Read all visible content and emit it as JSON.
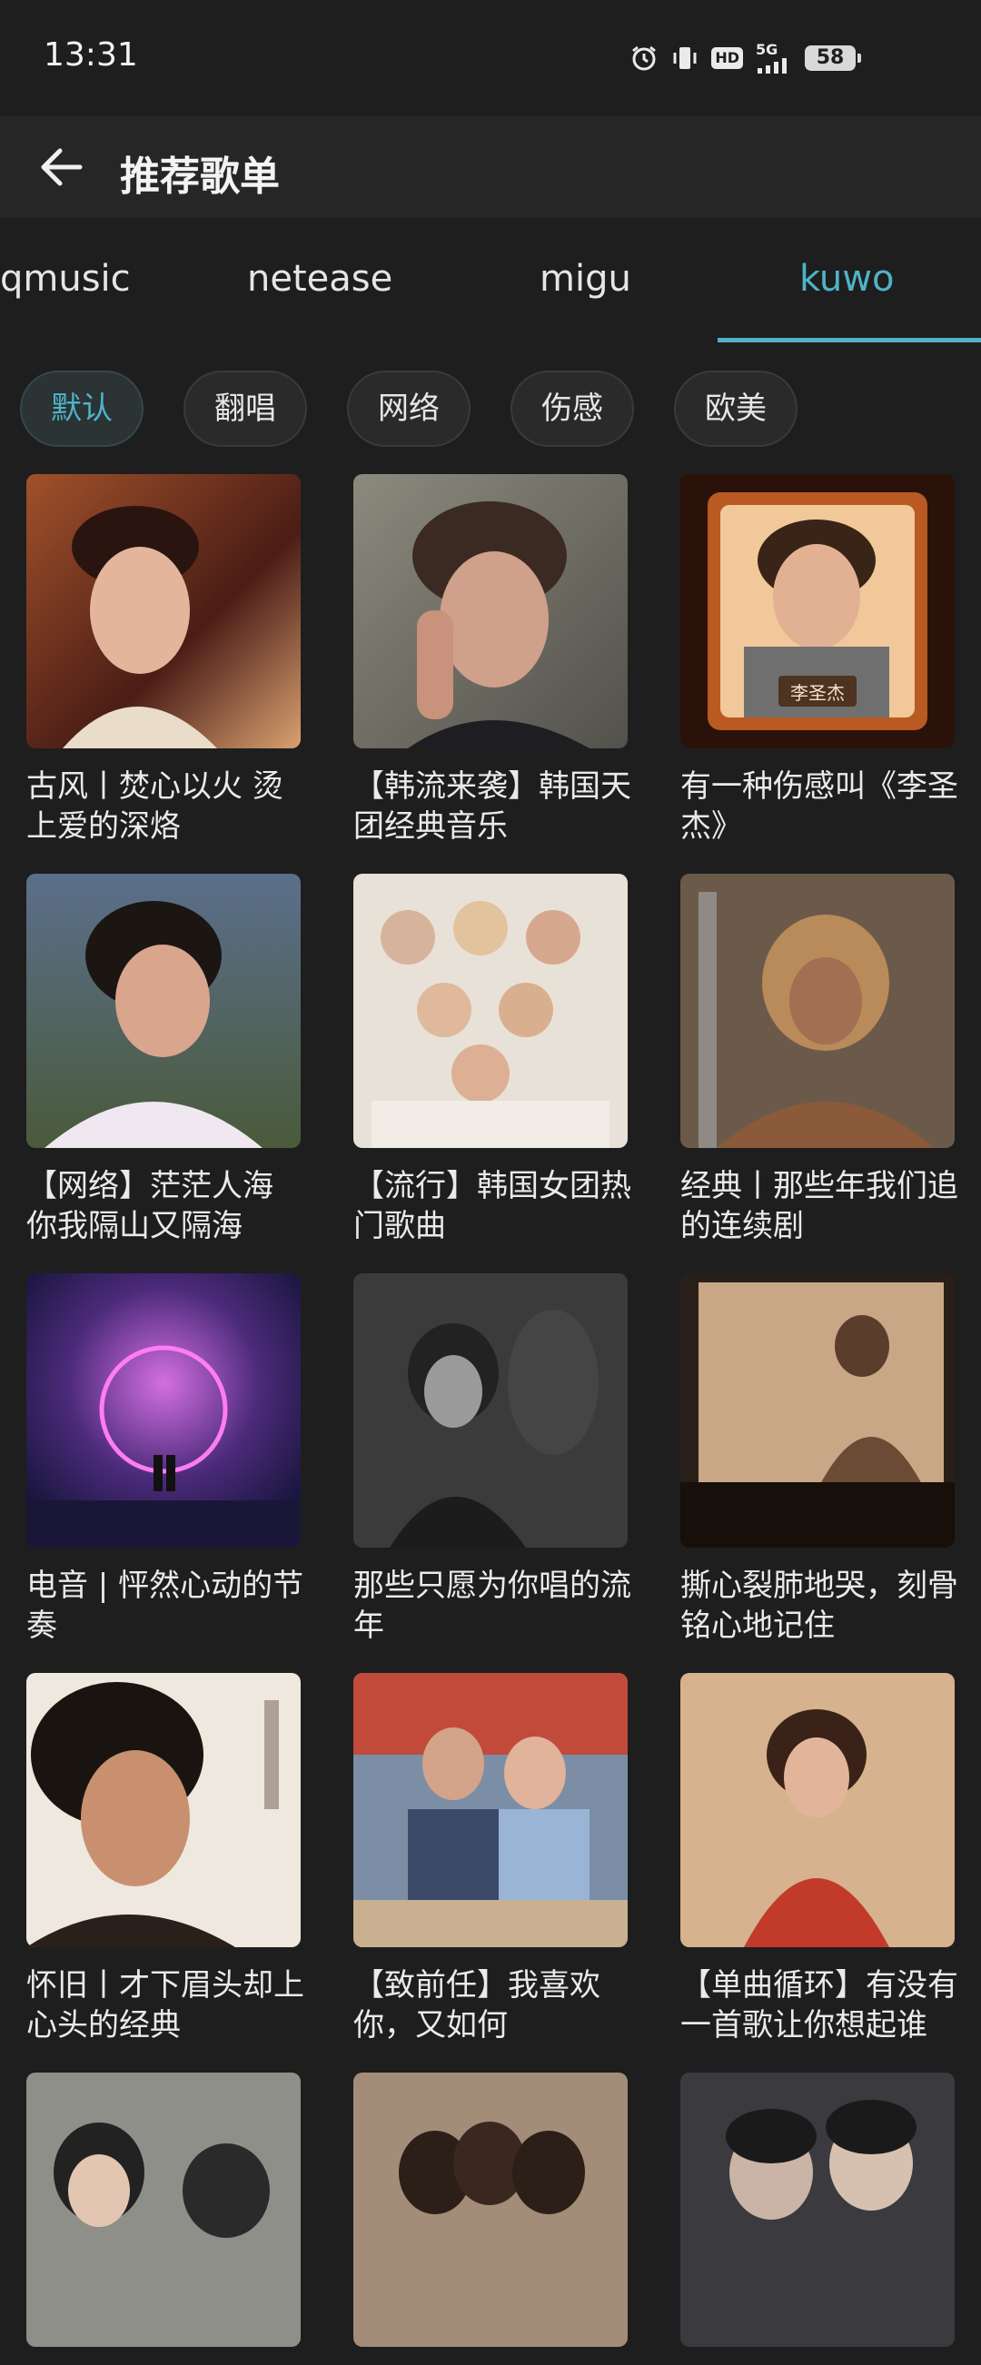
{
  "status_bar": {
    "time": "13:31",
    "network": "5G",
    "hd": "HD",
    "battery": "58",
    "icons": [
      "alarm-icon",
      "vibrate-icon",
      "hd-icon",
      "signal-icon",
      "battery-icon"
    ]
  },
  "header": {
    "title": "推荐歌单",
    "back_icon": "back-arrow-icon"
  },
  "tabs": [
    {
      "label": "qmusic",
      "active": false
    },
    {
      "label": "netease",
      "active": false
    },
    {
      "label": "migu",
      "active": false
    },
    {
      "label": "kuwo",
      "active": true
    }
  ],
  "chips": [
    {
      "label": "默认",
      "active": true
    },
    {
      "label": "翻唱",
      "active": false
    },
    {
      "label": "网络",
      "active": false
    },
    {
      "label": "伤感",
      "active": false
    },
    {
      "label": "欧美",
      "active": false
    }
  ],
  "playlists": [
    {
      "title": "古风丨焚心以火 烫上爱的深烙"
    },
    {
      "title": "【韩流来袭】韩国天团经典音乐"
    },
    {
      "title": "有一种伤感叫《李圣杰》",
      "cover_text": "李圣杰"
    },
    {
      "title": "【网络】茫茫人海 你我隔山又隔海"
    },
    {
      "title": "【流行】韩国女团热门歌曲"
    },
    {
      "title": "经典丨那些年我们追的连续剧"
    },
    {
      "title": "电音 | 怦然心动的节奏"
    },
    {
      "title": "那些只愿为你唱的流年"
    },
    {
      "title": "撕心裂肺地哭，刻骨铭心地记住"
    },
    {
      "title": "怀旧丨才下眉头却上心头的经典"
    },
    {
      "title": "【致前任】我喜欢你，又如何"
    },
    {
      "title": "【单曲循环】有没有一首歌让你想起谁"
    },
    {
      "title": ""
    },
    {
      "title": ""
    },
    {
      "title": ""
    }
  ],
  "colors": {
    "background": "#1e1e1e",
    "accent": "#4fb3c6",
    "appbar": "#262626"
  }
}
